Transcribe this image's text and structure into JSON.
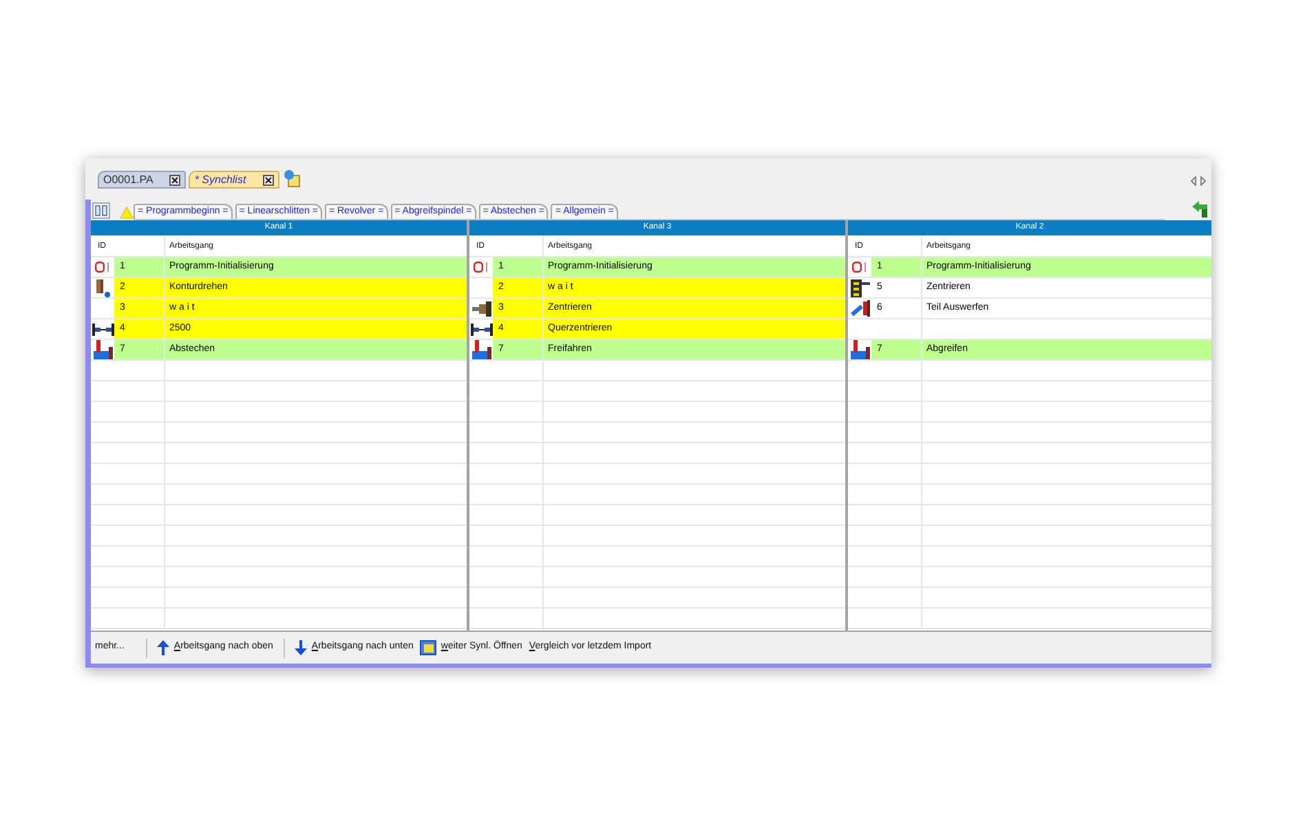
{
  "doc_tabs": [
    {
      "label": "O0001.PA",
      "selected": false
    },
    {
      "label": "* Synchlist",
      "selected": true
    }
  ],
  "section_tabs": [
    {
      "label": "= Programmbeginn =",
      "selected": false
    },
    {
      "label": "= Linearschlitten =",
      "selected": false
    },
    {
      "label": "= Revolver =",
      "selected": false
    },
    {
      "label": "= Abgreifspindel =",
      "selected": false
    },
    {
      "label": "= Abstechen =",
      "selected": false
    },
    {
      "label": "= Allgemein =",
      "selected": false
    }
  ],
  "channels": [
    {
      "title": "Kanal 1",
      "columns": [
        "ID",
        "Arbeitsgang"
      ],
      "rows": [
        {
          "kind": "start",
          "id": "1",
          "operation": "Programm-Initialisierung",
          "color": "#bfff8f"
        },
        {
          "kind": "turning",
          "id": "2",
          "operation": "Konturdrehen",
          "color": "#ffff00"
        },
        {
          "kind": "wait",
          "id": "3",
          "operation": "w a i t",
          "color": "#ffff00"
        },
        {
          "kind": "clamp",
          "id": "4",
          "operation": "2500",
          "color": "#ffff00"
        },
        {
          "kind": "partoff",
          "id": "7",
          "operation": "Abstechen",
          "color": "#bfff8f"
        }
      ]
    },
    {
      "title": "Kanal 3",
      "columns": [
        "ID",
        "Arbeitsgang"
      ],
      "rows": [
        {
          "kind": "start",
          "id": "1",
          "operation": "Programm-Initialisierung",
          "color": "#bfff8f"
        },
        {
          "kind": "wait",
          "id": "2",
          "operation": "w a i t",
          "color": "#ffff00"
        },
        {
          "kind": "centering",
          "id": "3",
          "operation": "Zentrieren",
          "color": "#ffff00"
        },
        {
          "kind": "clamp",
          "id": "4",
          "operation": "Querzentrieren",
          "color": "#ffff00"
        },
        {
          "kind": "partoff",
          "id": "7",
          "operation": "Freifahren",
          "color": "#bfff8f"
        }
      ]
    },
    {
      "title": "Kanal 2",
      "columns": [
        "ID",
        "Arbeitsgang"
      ],
      "rows": [
        {
          "kind": "start",
          "id": "1",
          "operation": "Programm-Initialisierung",
          "color": "#bfff8f"
        },
        {
          "kind": "fixture",
          "id": "5",
          "operation": "Zentrieren",
          "color": "#ffffff"
        },
        {
          "kind": "eject",
          "id": "6",
          "operation": "Teil Auswerfen",
          "color": "#ffffff"
        },
        {
          "kind": "empty"
        },
        {
          "kind": "partoff",
          "id": "7",
          "operation": "Abgreifen",
          "color": "#bfff8f"
        }
      ]
    }
  ],
  "toolbar": {
    "groups": [
      {
        "items": [
          {
            "kind": "more",
            "label": "mehr...",
            "underline_first": false
          }
        ]
      },
      {
        "items": [
          {
            "kind": "up",
            "label": "Arbeitsgang nach oben",
            "underline_first": true
          }
        ]
      },
      {
        "items": [
          {
            "kind": "down",
            "label": "Arbeitsgang nach unten",
            "underline_first": true
          },
          {
            "kind": "open",
            "label": "weiter Synl. Öffnen",
            "underline_first": true
          },
          {
            "kind": "compare",
            "label": "Vergleich vor letzdem Import",
            "underline_first": true
          }
        ]
      }
    ]
  }
}
